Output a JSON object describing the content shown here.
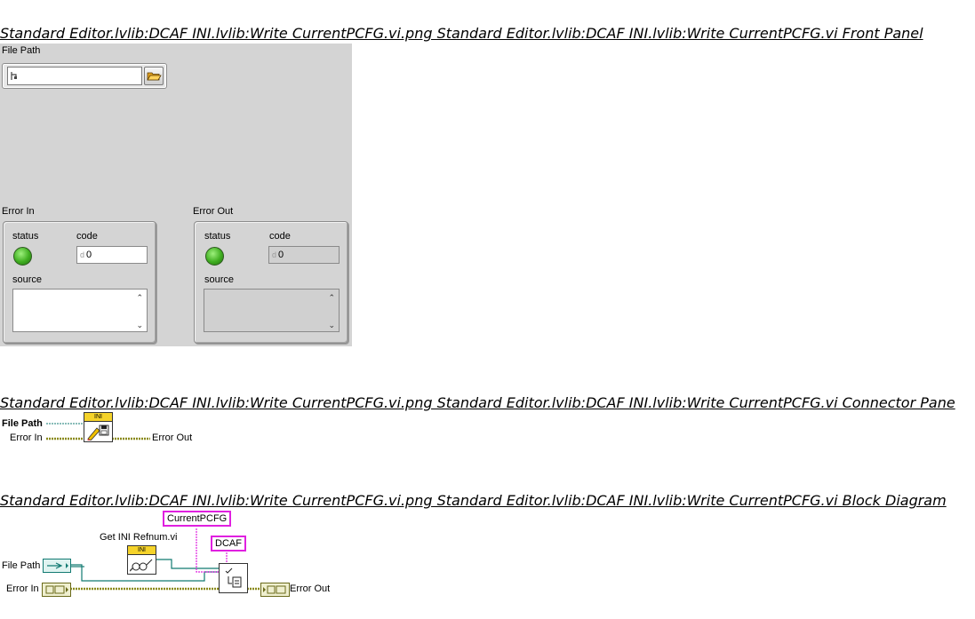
{
  "titles": {
    "front_panel": "Standard Editor.lvlib:DCAF INI.lvlib:Write CurrentPCFG.vi.png  Standard Editor.lvlib:DCAF INI.lvlib:Write CurrentPCFG.vi Front Panel",
    "connector_pane": "Standard Editor.lvlib:DCAF INI.lvlib:Write CurrentPCFG.vi.png  Standard Editor.lvlib:DCAF INI.lvlib:Write CurrentPCFG.vi Connector Pane",
    "block_diagram": "Standard Editor.lvlib:DCAF INI.lvlib:Write CurrentPCFG.vi.png  Standard Editor.lvlib:DCAF INI.lvlib:Write CurrentPCFG.vi Block Diagram"
  },
  "front_panel": {
    "file_path": {
      "label": "File Path",
      "value": ""
    },
    "error_in": {
      "label": "Error In",
      "status_label": "status",
      "code_label": "code",
      "code_value": "0",
      "radix": "d",
      "source_label": "source",
      "source_value": ""
    },
    "error_out": {
      "label": "Error Out",
      "status_label": "status",
      "code_label": "code",
      "code_value": "0",
      "radix": "d",
      "source_label": "source",
      "source_value": ""
    }
  },
  "connector_pane": {
    "file_path_label": "File Path",
    "error_in_label": "Error In",
    "error_out_label": "Error Out",
    "icon_text": "INI"
  },
  "block_diagram": {
    "subvi_label": "Get INI Refnum.vi",
    "subvi_icon_text": "INI",
    "constant_section": "CurrentPCFG",
    "constant_key": "DCAF",
    "file_path_label": "File Path",
    "error_in_label": "Error In",
    "error_out_label": "Error Out"
  },
  "colors": {
    "panel_bg": "#d4d4d4",
    "led_green": "#3fae20",
    "string_constant": "#e020e0",
    "path_wire": "#127a72",
    "error_wire": "#8a8a1a"
  }
}
